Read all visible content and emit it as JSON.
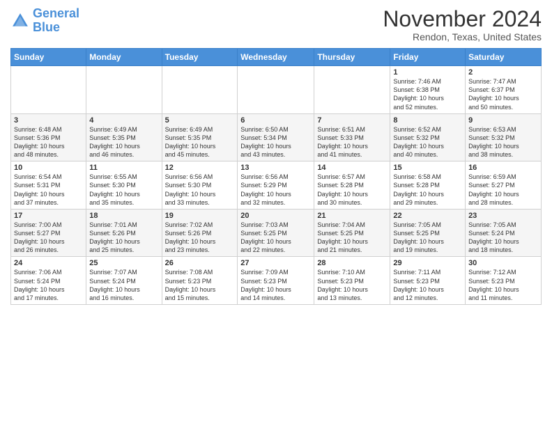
{
  "header": {
    "logo_line1": "General",
    "logo_line2": "Blue",
    "month_year": "November 2024",
    "location": "Rendon, Texas, United States"
  },
  "weekdays": [
    "Sunday",
    "Monday",
    "Tuesday",
    "Wednesday",
    "Thursday",
    "Friday",
    "Saturday"
  ],
  "weeks": [
    [
      {
        "day": "",
        "info": ""
      },
      {
        "day": "",
        "info": ""
      },
      {
        "day": "",
        "info": ""
      },
      {
        "day": "",
        "info": ""
      },
      {
        "day": "",
        "info": ""
      },
      {
        "day": "1",
        "info": "Sunrise: 7:46 AM\nSunset: 6:38 PM\nDaylight: 10 hours\nand 52 minutes."
      },
      {
        "day": "2",
        "info": "Sunrise: 7:47 AM\nSunset: 6:37 PM\nDaylight: 10 hours\nand 50 minutes."
      }
    ],
    [
      {
        "day": "3",
        "info": "Sunrise: 6:48 AM\nSunset: 5:36 PM\nDaylight: 10 hours\nand 48 minutes."
      },
      {
        "day": "4",
        "info": "Sunrise: 6:49 AM\nSunset: 5:35 PM\nDaylight: 10 hours\nand 46 minutes."
      },
      {
        "day": "5",
        "info": "Sunrise: 6:49 AM\nSunset: 5:35 PM\nDaylight: 10 hours\nand 45 minutes."
      },
      {
        "day": "6",
        "info": "Sunrise: 6:50 AM\nSunset: 5:34 PM\nDaylight: 10 hours\nand 43 minutes."
      },
      {
        "day": "7",
        "info": "Sunrise: 6:51 AM\nSunset: 5:33 PM\nDaylight: 10 hours\nand 41 minutes."
      },
      {
        "day": "8",
        "info": "Sunrise: 6:52 AM\nSunset: 5:32 PM\nDaylight: 10 hours\nand 40 minutes."
      },
      {
        "day": "9",
        "info": "Sunrise: 6:53 AM\nSunset: 5:32 PM\nDaylight: 10 hours\nand 38 minutes."
      }
    ],
    [
      {
        "day": "10",
        "info": "Sunrise: 6:54 AM\nSunset: 5:31 PM\nDaylight: 10 hours\nand 37 minutes."
      },
      {
        "day": "11",
        "info": "Sunrise: 6:55 AM\nSunset: 5:30 PM\nDaylight: 10 hours\nand 35 minutes."
      },
      {
        "day": "12",
        "info": "Sunrise: 6:56 AM\nSunset: 5:30 PM\nDaylight: 10 hours\nand 33 minutes."
      },
      {
        "day": "13",
        "info": "Sunrise: 6:56 AM\nSunset: 5:29 PM\nDaylight: 10 hours\nand 32 minutes."
      },
      {
        "day": "14",
        "info": "Sunrise: 6:57 AM\nSunset: 5:28 PM\nDaylight: 10 hours\nand 30 minutes."
      },
      {
        "day": "15",
        "info": "Sunrise: 6:58 AM\nSunset: 5:28 PM\nDaylight: 10 hours\nand 29 minutes."
      },
      {
        "day": "16",
        "info": "Sunrise: 6:59 AM\nSunset: 5:27 PM\nDaylight: 10 hours\nand 28 minutes."
      }
    ],
    [
      {
        "day": "17",
        "info": "Sunrise: 7:00 AM\nSunset: 5:27 PM\nDaylight: 10 hours\nand 26 minutes."
      },
      {
        "day": "18",
        "info": "Sunrise: 7:01 AM\nSunset: 5:26 PM\nDaylight: 10 hours\nand 25 minutes."
      },
      {
        "day": "19",
        "info": "Sunrise: 7:02 AM\nSunset: 5:26 PM\nDaylight: 10 hours\nand 23 minutes."
      },
      {
        "day": "20",
        "info": "Sunrise: 7:03 AM\nSunset: 5:25 PM\nDaylight: 10 hours\nand 22 minutes."
      },
      {
        "day": "21",
        "info": "Sunrise: 7:04 AM\nSunset: 5:25 PM\nDaylight: 10 hours\nand 21 minutes."
      },
      {
        "day": "22",
        "info": "Sunrise: 7:05 AM\nSunset: 5:25 PM\nDaylight: 10 hours\nand 19 minutes."
      },
      {
        "day": "23",
        "info": "Sunrise: 7:05 AM\nSunset: 5:24 PM\nDaylight: 10 hours\nand 18 minutes."
      }
    ],
    [
      {
        "day": "24",
        "info": "Sunrise: 7:06 AM\nSunset: 5:24 PM\nDaylight: 10 hours\nand 17 minutes."
      },
      {
        "day": "25",
        "info": "Sunrise: 7:07 AM\nSunset: 5:24 PM\nDaylight: 10 hours\nand 16 minutes."
      },
      {
        "day": "26",
        "info": "Sunrise: 7:08 AM\nSunset: 5:23 PM\nDaylight: 10 hours\nand 15 minutes."
      },
      {
        "day": "27",
        "info": "Sunrise: 7:09 AM\nSunset: 5:23 PM\nDaylight: 10 hours\nand 14 minutes."
      },
      {
        "day": "28",
        "info": "Sunrise: 7:10 AM\nSunset: 5:23 PM\nDaylight: 10 hours\nand 13 minutes."
      },
      {
        "day": "29",
        "info": "Sunrise: 7:11 AM\nSunset: 5:23 PM\nDaylight: 10 hours\nand 12 minutes."
      },
      {
        "day": "30",
        "info": "Sunrise: 7:12 AM\nSunset: 5:23 PM\nDaylight: 10 hours\nand 11 minutes."
      }
    ]
  ]
}
